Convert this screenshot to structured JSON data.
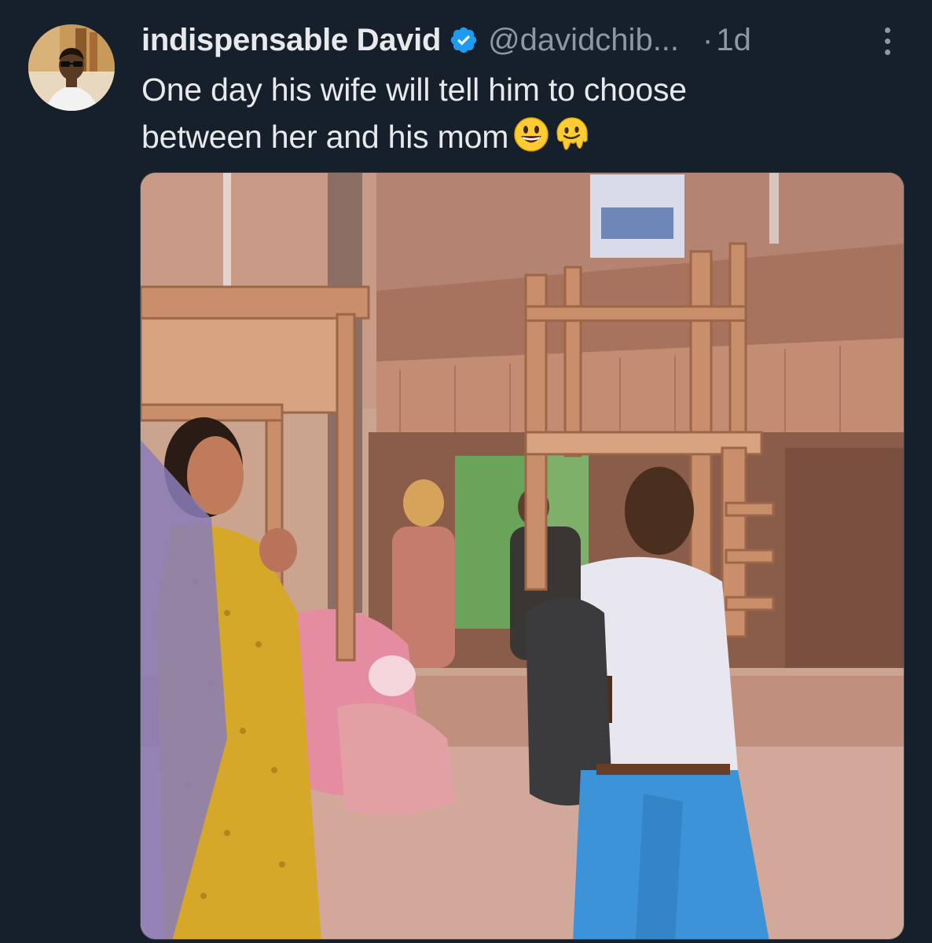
{
  "tweet": {
    "author": {
      "display_name": "indispensable David",
      "handle": "@davidchib...",
      "verified": true,
      "verified_icon": "verified-badge-icon"
    },
    "separator": "·",
    "time_ago": "1d",
    "more_icon": "more-options-icon",
    "text_line1": "One day his wife will tell him to choose",
    "text_line2": "between her and his mom",
    "emojis": [
      "grinning-face-emoji",
      "melting-face-emoji"
    ],
    "media": {
      "type": "photo"
    }
  },
  "colors": {
    "background": "#15202b",
    "text_primary": "#e7e9ea",
    "text_secondary": "#8b98a5",
    "verified_blue": "#1d9bf0"
  }
}
